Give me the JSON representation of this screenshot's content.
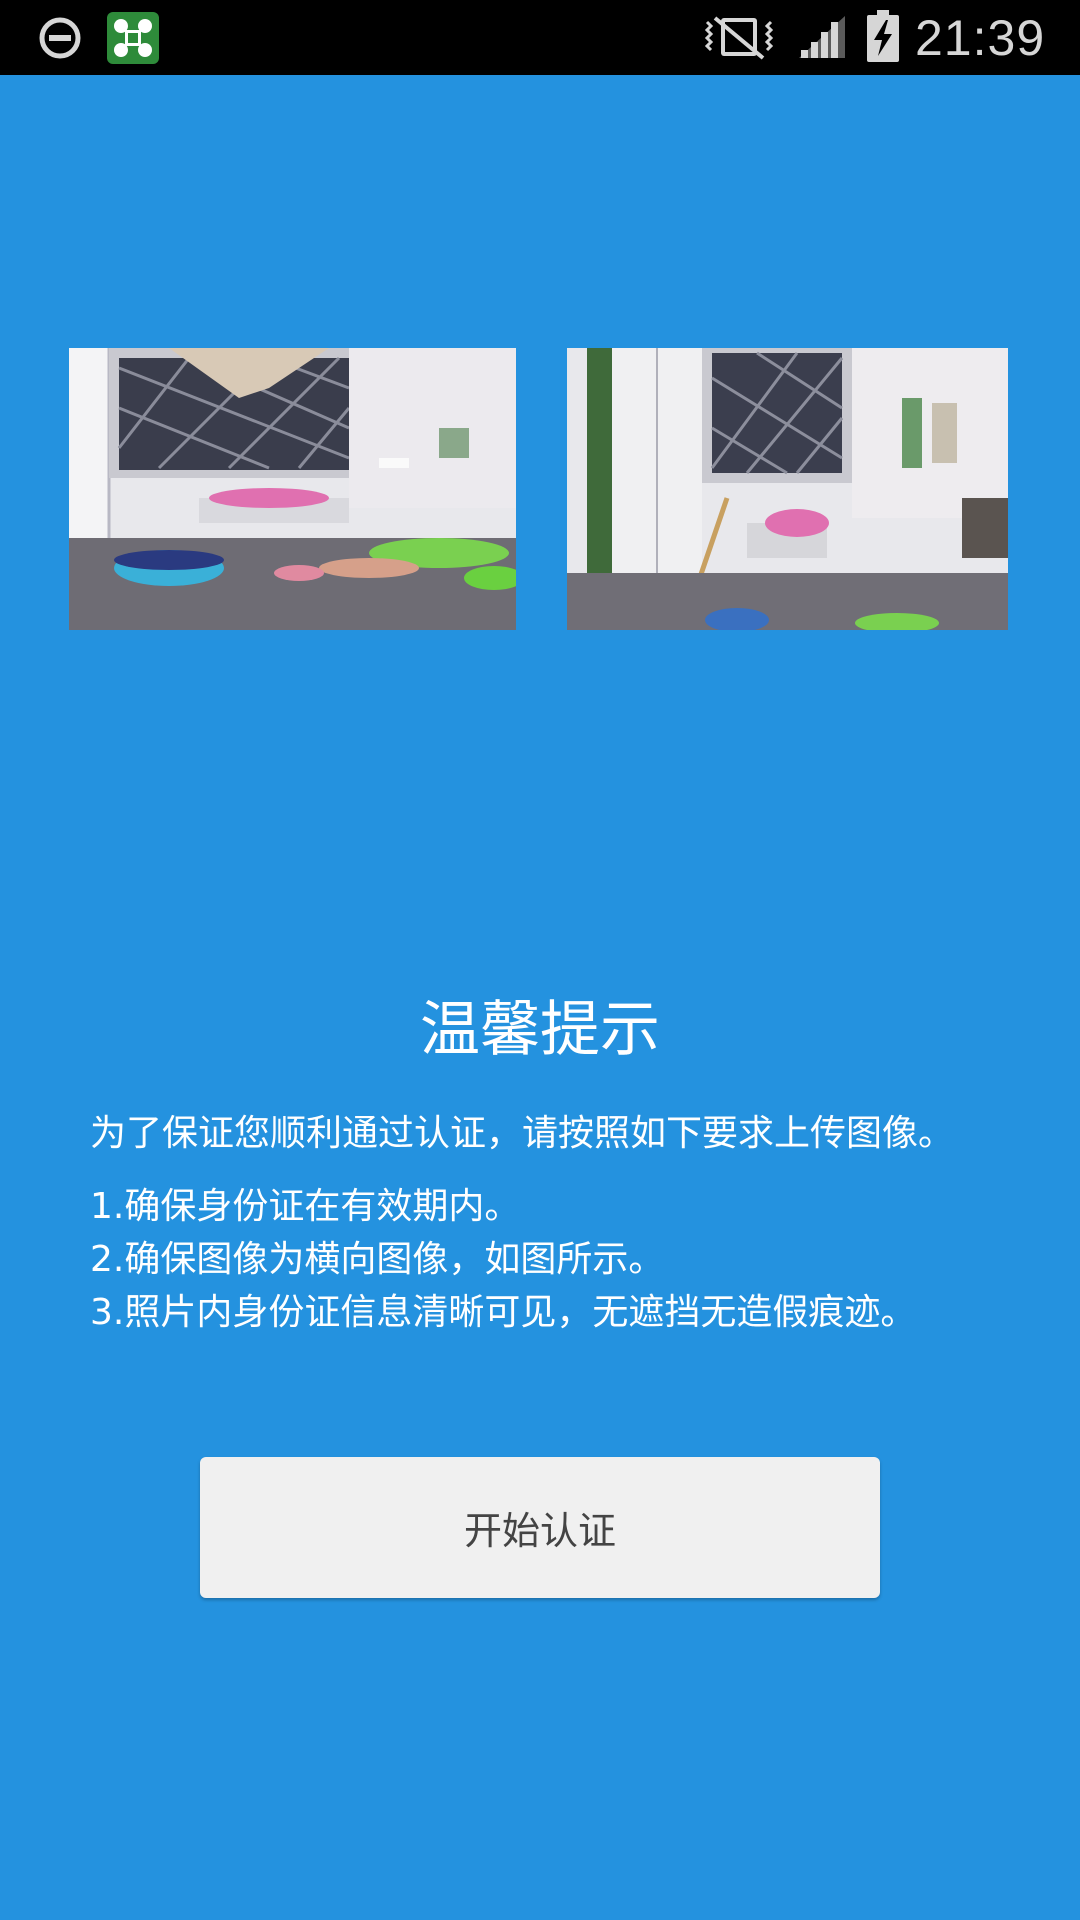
{
  "status_bar": {
    "time": "21:39",
    "icons": [
      "do-not-disturb-icon",
      "app-notification-icon",
      "vibrate-icon",
      "signal-icon",
      "battery-charging-icon"
    ]
  },
  "sample_images": [
    {
      "name": "sample-photo-left"
    },
    {
      "name": "sample-photo-right"
    }
  ],
  "tips": {
    "title": "温馨提示",
    "intro": "为了保证您顺利通过认证，请按照如下要求上传图像。",
    "items": [
      "1.确保身份证在有效期内。",
      "2.确保图像为横向图像，如图所示。",
      "3.照片内身份证信息清晰可见，无遮挡无造假痕迹。"
    ]
  },
  "actions": {
    "start_label": "开始认证"
  },
  "colors": {
    "background": "#2492df",
    "status_bar": "#000000",
    "button_bg": "#f0f0f0",
    "button_text": "#444444"
  }
}
